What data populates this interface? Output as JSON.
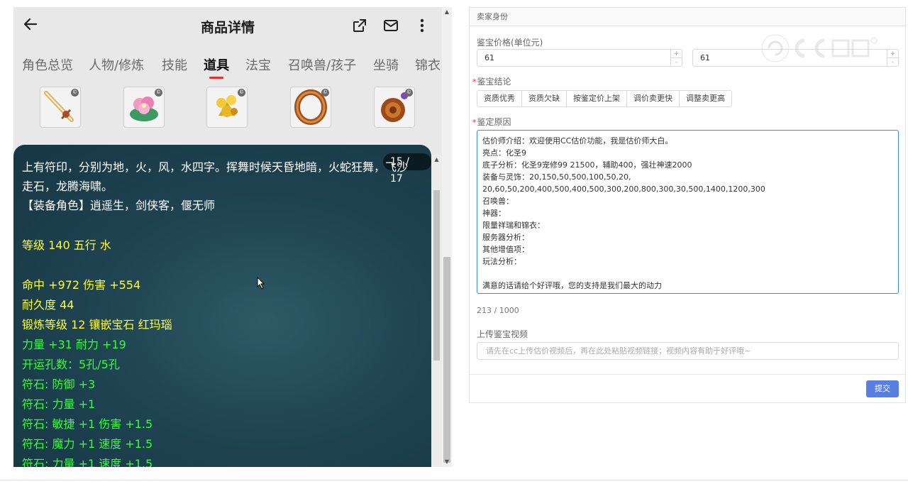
{
  "phone": {
    "title": "商品详情",
    "tabs": [
      "角色总览",
      "人物/修炼",
      "技能",
      "道具",
      "法宝",
      "召唤兽/孩子",
      "坐骑",
      "锦衣"
    ],
    "active_tab": "道具",
    "item_icons": [
      "sword-item-icon",
      "lotus-item-icon",
      "golden-flower-item-icon",
      "bronze-ring-item-icon",
      "amulet-item-icon"
    ],
    "item_badge": "©",
    "pager": "15 / 17",
    "desc_lines": [
      {
        "text": "上有符印，分别为地，火，风，水四字。挥舞时候天昏地暗，火蛇狂舞，飞沙",
        "color": "white"
      },
      {
        "text": "走石，龙腾海啸。",
        "color": "white"
      },
      {
        "text": "【装备角色】逍遥生，剑侠客，偃无师",
        "color": "white"
      },
      {
        "text": "等级 140 五行 水",
        "color": "yellow"
      },
      {
        "text": "命中 +972 伤害 +554",
        "color": "yellow"
      },
      {
        "text": "耐久度 44",
        "color": "yellow"
      },
      {
        "text": "锻炼等级 12 镶嵌宝石 红玛瑙",
        "color": "yellow"
      },
      {
        "text": "力量 +31 耐力 +19",
        "color": "green"
      },
      {
        "text": "开运孔数：5孔/5孔",
        "color": "green"
      },
      {
        "text": "符石: 防御 +3",
        "color": "green"
      },
      {
        "text": "符石: 力量 +1",
        "color": "green"
      },
      {
        "text": "符石: 敏捷 +1 伤害 +1.5",
        "color": "green"
      },
      {
        "text": "符石: 魔力 +1 速度 +1.5",
        "color": "green"
      },
      {
        "text": "符石: 力量 +1 速度 +1.5",
        "color": "green"
      }
    ]
  },
  "form": {
    "header": "卖家身份",
    "price_label": "鉴宝价格(单位元)",
    "price_min": "61",
    "price_max": "61",
    "conclusion_label": "鉴宝结论",
    "conclusion_options": [
      "资质优秀",
      "资质欠缺",
      "按鉴定价上架",
      "调价卖更快",
      "调整卖更高"
    ],
    "reason_label": "鉴定原因",
    "reason_text": "估价师介绍：欢迎使用CC估价功能，我是估价师大白。\n亮点：化圣9\n底子分析：化圣9宠修99 21500，辅助400，强壮神速2000\n装备与灵饰：20,150,50,500,100,50,20,\n20,60,50,200,400,500,400,500,300,200,800,300,30,500,1400,1200,300\n召唤兽：\n神器：\n限量祥瑞和锦衣：\n服务器分析：\n其他增值项：\n玩法分析：\n\n满意的话请给个好评哦，您的支持是我们最大的动力",
    "char_counter": "213 / 1000",
    "video_label": "上传鉴宝视频",
    "video_placeholder": "请先在cc上传估价视频后，再在此处粘贴视频链接；视频内容有助于好评哦~",
    "submit": "提交",
    "required_mark": "*",
    "step_up": "+",
    "step_down": "-"
  },
  "colors": {
    "white": "#ffffff",
    "yellow": "#ffff33",
    "green": "#33ff33",
    "accent": "#5b7fe0",
    "tab_underline": "#e23333"
  }
}
